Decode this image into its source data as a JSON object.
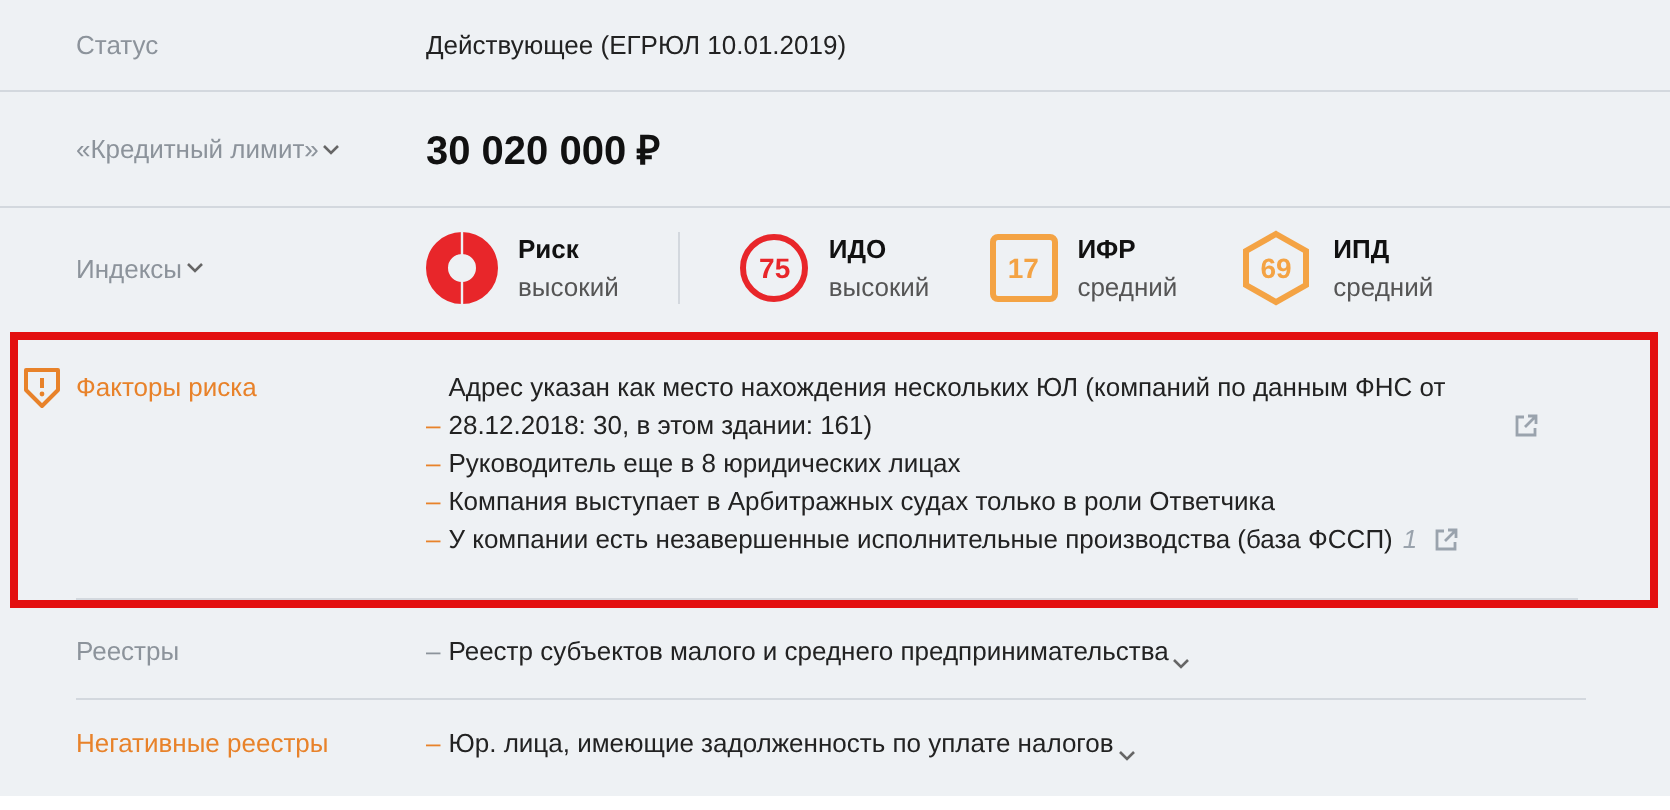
{
  "rows": [
    {
      "kind": "text",
      "label": "Статус",
      "value": "Действующее (ЕГРЮЛ 10.01.2019)"
    },
    {
      "kind": "amount",
      "label": "«Кредитный лимит»",
      "expandable": true,
      "value": "30 020 000 ₽"
    },
    {
      "kind": "indices",
      "label": "Индексы",
      "expandable": true,
      "indices": [
        {
          "kind": "ring",
          "name": "Риск",
          "grade": "высокий",
          "color": "#e8262a"
        },
        {
          "kind": "circle",
          "value": "75",
          "name": "ИДО",
          "grade": "высокий",
          "color": "#e8262a"
        },
        {
          "kind": "square",
          "value": "17",
          "name": "ИФР",
          "grade": "средний",
          "color": "#f4a344"
        },
        {
          "kind": "hexagon",
          "value": "69",
          "name": "ИПД",
          "grade": "средний",
          "color": "#f4a344"
        }
      ]
    },
    {
      "kind": "list",
      "label": "Факторы риска",
      "warning": true,
      "highlighted": true,
      "negative": true,
      "items": [
        {
          "bullet": "–",
          "text": "Адрес указан как место нахождения нескольких ЮЛ (компаний по данным ФНС от 28.12.2018: 30, в этом здании: 161)",
          "link": true
        },
        {
          "bullet": "–",
          "text": "Руководитель еще в 8 юридических лицах"
        },
        {
          "bullet": "–",
          "text": "Компания выступает в Арбитражных судах только в роли Ответчика"
        },
        {
          "bullet": "–",
          "text": "У компании есть незавершенные исполнительные производства (база ФССП)",
          "count": "1",
          "link": true
        }
      ]
    },
    {
      "kind": "list",
      "label": "Реестры",
      "negative": false,
      "items": [
        {
          "bullet": "–",
          "text": "Реестр субъектов малого и среднего предпринимательства",
          "expandable": true
        }
      ]
    },
    {
      "kind": "list",
      "label": "Негативные реестры",
      "negative": true,
      "items": [
        {
          "bullet": "–",
          "text": "Юр. лица, имеющие задолженность по уплате налогов",
          "expandable": true
        }
      ]
    }
  ]
}
